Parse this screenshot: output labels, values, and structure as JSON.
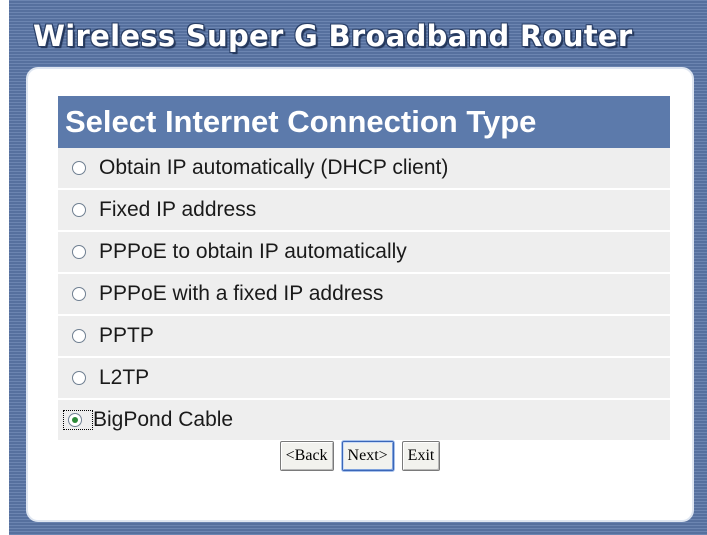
{
  "app": {
    "title": "Wireless Super G Broadband Router"
  },
  "section": {
    "heading": "Select Internet Connection Type"
  },
  "options": [
    {
      "label": "Obtain IP automatically (DHCP client)",
      "selected": false
    },
    {
      "label": "Fixed IP address",
      "selected": false
    },
    {
      "label": "PPPoE to obtain IP automatically",
      "selected": false
    },
    {
      "label": "PPPoE with a fixed IP address",
      "selected": false
    },
    {
      "label": "PPTP",
      "selected": false
    },
    {
      "label": "L2TP",
      "selected": false
    },
    {
      "label": "BigPond Cable",
      "selected": true
    }
  ],
  "buttons": {
    "back": "<Back",
    "next": "Next>",
    "exit": "Exit"
  },
  "colors": {
    "frame_blue": "#5b77a8",
    "header_blue": "#5c7aab",
    "row_gray": "#eeeeee",
    "radio_dot_green": "#2e8b3a"
  }
}
